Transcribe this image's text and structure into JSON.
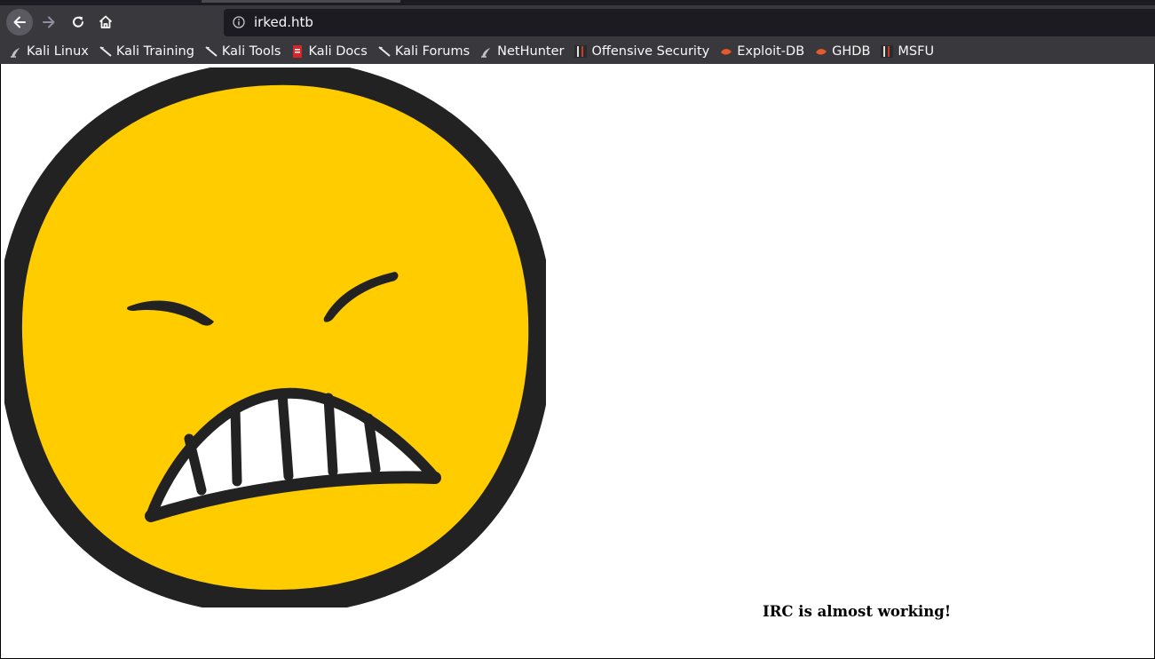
{
  "browser": {
    "url": "irked.htb",
    "icons": {
      "back": "arrow-left-icon",
      "forward": "arrow-right-icon",
      "reload": "reload-icon",
      "home": "home-icon",
      "site_info": "info-icon"
    },
    "bookmarks": [
      {
        "label": "Kali Linux",
        "icon": "kali-dragon-icon"
      },
      {
        "label": "Kali Training",
        "icon": "kali-dragon-icon"
      },
      {
        "label": "Kali Tools",
        "icon": "kali-dragon-icon"
      },
      {
        "label": "Kali Docs",
        "icon": "kali-docs-icon"
      },
      {
        "label": "Kali Forums",
        "icon": "kali-dragon-icon"
      },
      {
        "label": "NetHunter",
        "icon": "kali-dragon-icon"
      },
      {
        "label": "Offensive Security",
        "icon": "offsec-icon"
      },
      {
        "label": "Exploit-DB",
        "icon": "exploitdb-icon"
      },
      {
        "label": "GHDB",
        "icon": "exploitdb-icon"
      },
      {
        "label": "MSFU",
        "icon": "offsec-icon"
      }
    ]
  },
  "page": {
    "image": "angry-face-emoji",
    "message": "IRC is almost working!"
  },
  "colors": {
    "toolbar": "#38383d",
    "urlbar": "#1c1b22",
    "face_fill": "#ffcc00",
    "face_outline": "#222222"
  }
}
